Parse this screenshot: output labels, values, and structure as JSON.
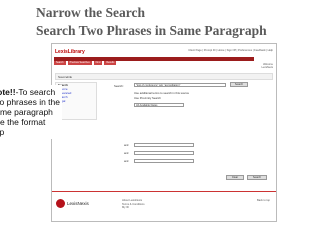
{
  "slide": {
    "title_line1": "Narrow the Search",
    "title_line2": "Search Two Phrases in Same Paragraph"
  },
  "app": {
    "logo": "LexisLibrary",
    "header_links": "Client Page | Prompt ID | Home | Sign Off | Preferences | Feedback | Help",
    "tabs": [
      "Search",
      "Previous Searches",
      "Find",
      "Results"
    ],
    "user_lines": [
      "Welcome",
      "LexisNexis"
    ],
    "breadcrumb": "Sourcelink",
    "sidebar": {
      "heading": "Search",
      "items": [
        "Source",
        "Advanced",
        "Search",
        "Legal"
      ]
    },
    "search": {
      "label": "Search:",
      "value": "\"lost of conference\" w/p \"accreditation\"",
      "button": "Search"
    },
    "options": [
      "Use additional terms to search in this source",
      "Use Proximity Search"
    ],
    "dropdown_value": "All Available Dates",
    "rows": [
      {
        "label": "and",
        "value": ""
      },
      {
        "label": "and",
        "value": ""
      },
      {
        "label": "and",
        "value": ""
      }
    ],
    "buttons": {
      "clear": "Clear",
      "search": "Search"
    },
    "footer": {
      "logo_text": "LexisNexis",
      "links": [
        "About LexisNexis",
        "Terms & Conditions",
        "My ID"
      ],
      "copyright": "Copyright 2011 LexisNexis",
      "right": "Back to top"
    }
  },
  "note": {
    "bold": "Note!!",
    "text": "-To search two phrases in the same paragraph use the format w/p"
  }
}
